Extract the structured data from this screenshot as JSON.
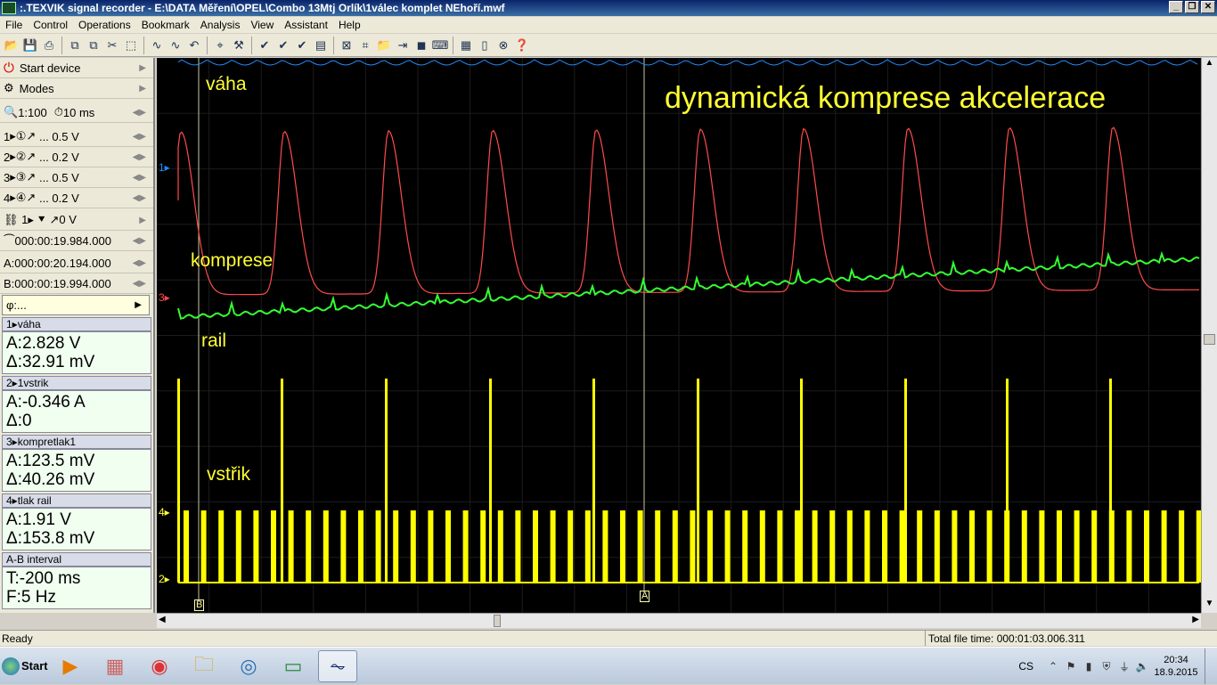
{
  "window": {
    "title": ":.TEXVIK  signal recorder - E:\\DATA Měření\\OPEL\\Combo 13Mtj Orlík\\1válec komplet NEhoří.mwf"
  },
  "menu": [
    "File",
    "Control",
    "Operations",
    "Bookmark",
    "Analysis",
    "View",
    "Assistant",
    "Help"
  ],
  "left": {
    "start": "Start device",
    "modes": "Modes",
    "zoom": "1:100",
    "timebase": "10 ms",
    "channels": [
      {
        "num": "1",
        "circ": "①",
        "val": "... 0.5 V"
      },
      {
        "num": "2",
        "circ": "②",
        "val": "... 0.2 V"
      },
      {
        "num": "3",
        "circ": "③",
        "val": "... 0.5 V"
      },
      {
        "num": "4",
        "circ": "④",
        "val": "... 0.2 V"
      }
    ],
    "trigger": "1▸ ⯆ ↗0 V",
    "trigpos": "000:00:19.984.000",
    "cursorA": "A:000:00:20.194.000",
    "cursorB": "B:000:00:19.994.000",
    "phi": "φ:..."
  },
  "info": [
    {
      "hdr": "1▸váha",
      "a": "A:2.828 V",
      "d": "Δ:32.91 mV"
    },
    {
      "hdr": "2▸1vstrik",
      "a": "A:-0.346 A",
      "d": "Δ:0"
    },
    {
      "hdr": "3▸kompretlak1",
      "a": "A:123.5 mV",
      "d": "Δ:40.26 mV"
    },
    {
      "hdr": "4▸tlak rail",
      "a": "A:1.91 V",
      "d": "Δ:153.8 mV"
    }
  ],
  "ab": {
    "hdr": "A-B interval",
    "t": "T:-200 ms",
    "f": "F:5 Hz"
  },
  "scope": {
    "title": "dynamická komprese akcelerace",
    "labels": {
      "vaha": "váha",
      "komprese": "komprese",
      "rail": "rail",
      "vstrik": "vstřik"
    },
    "markers": [
      "1▸",
      "3▸",
      "4▸",
      "2▸"
    ],
    "cursors": [
      "B",
      "A"
    ],
    "colors": {
      "ch1": "#1e8cff",
      "ch3": "#ff4b4b",
      "rail": "#33ff33",
      "inj": "#ffff00"
    }
  },
  "status": {
    "left": "Ready",
    "right": "Total file time: 000:01:03.006.311"
  },
  "tray": {
    "lang": "CS",
    "time": "20:34",
    "date": "18.9.2015"
  }
}
